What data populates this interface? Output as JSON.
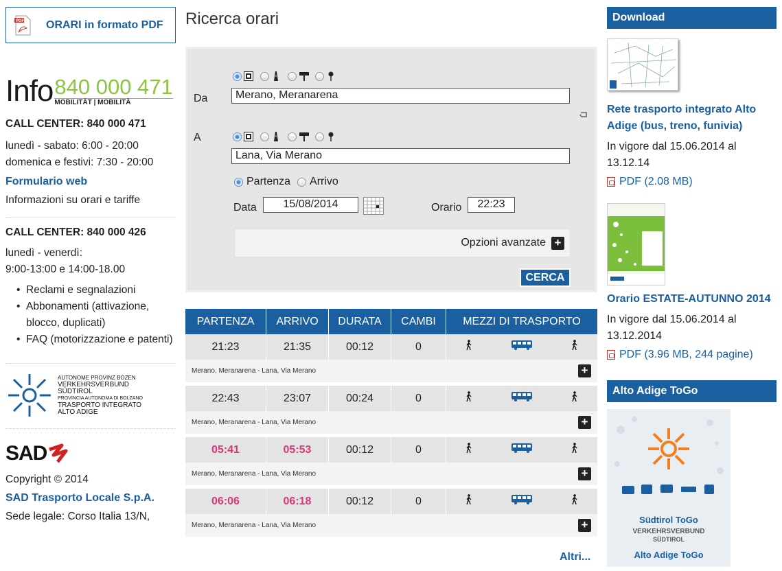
{
  "left": {
    "pdf_button": "ORARI in formato PDF",
    "info_logo": {
      "word": "Info",
      "number": "840 000 471",
      "sub": "MOBILITÄT | MOBILITÀ"
    },
    "callcenter1": {
      "title": "CALL CENTER: 840 000 471",
      "line1": "lunedì - sabato: 6:00 - 20:00",
      "line2": "domenica e festivi: 7:30 - 20:00"
    },
    "form_link": "Formulario web",
    "form_desc": "Informazioni su orari e tariffe",
    "callcenter2": {
      "title": "CALL CENTER: 840 000 426",
      "line1": "lunedì - venerdì:",
      "line2": "9:00-13:00 e 14:00-18.00"
    },
    "bullets": [
      "Reclami e segnalazioni",
      "Abbonamenti (attivazione, blocco, duplicati)",
      "FAQ (motorizzazione e patenti)"
    ],
    "vv_logo": {
      "l1": "AUTONOME PROVINZ BOZEN",
      "l2": "VERKEHRSVERBUND",
      "l3": "SÜDTIROL",
      "l4": "PROVINCIA AUTONOMA DI BOLZANO",
      "l5": "TRASPORTO INTEGRATO",
      "l6": "ALTO ADIGE"
    },
    "sad_logo": "SAD",
    "copyright": "Copyright © 2014",
    "company": "SAD Trasporto Locale S.p.A.",
    "address": "Sede legale: Corso Italia 13/N,"
  },
  "center": {
    "title": "Ricerca orari",
    "from_label": "Da",
    "from_value": "Merano, Meranarena",
    "to_label": "A",
    "to_value": "Lana, Via Merano",
    "departure": "Partenza",
    "arrival": "Arrivo",
    "date_label": "Data",
    "date_value": "15/08/2014",
    "time_label": "Orario",
    "time_value": "22:23",
    "advanced": "Opzioni avanzate",
    "search": "CERCA",
    "table": {
      "headers": [
        "PARTENZA",
        "ARRIVO",
        "DURATA",
        "CAMBI",
        "MEZZI DI TRASPORTO"
      ],
      "rows": [
        {
          "dep": "21:23",
          "arr": "21:35",
          "dur": "00:12",
          "chg": "0",
          "route": "Merano, Meranarena - Lana, Via Merano",
          "highlight": false
        },
        {
          "dep": "22:43",
          "arr": "23:07",
          "dur": "00:24",
          "chg": "0",
          "route": "Merano, Meranarena - Lana, Via Merano",
          "highlight": false
        },
        {
          "dep": "05:41",
          "arr": "05:53",
          "dur": "00:12",
          "chg": "0",
          "route": "Merano, Meranarena - Lana, Via Merano",
          "highlight": true
        },
        {
          "dep": "06:06",
          "arr": "06:18",
          "dur": "00:12",
          "chg": "0",
          "route": "Merano, Meranarena - Lana, Via Merano",
          "highlight": true
        }
      ]
    },
    "more": "Altri..."
  },
  "right": {
    "download_title": "Download",
    "item1": {
      "title": "Rete trasporto integrato Alto Adige (bus, treno, funivia)",
      "valid": "In vigore dal 15.06.2014 al 13.12.14",
      "pdf": "PDF (2.08 MB)"
    },
    "item2": {
      "title": "Orario ESTATE-AUTUNNO 2014",
      "valid": "In vigore dal 15.06.2014 al 13.12.2014",
      "pdf": "PDF (3.96 MB, 244 pagine)"
    },
    "togo_title": "Alto Adige ToGo",
    "togo_banner": {
      "l1": "Südtirol ToGo",
      "l2": "VERKEHRSVERBUND",
      "l3": "SÜDTIROL",
      "l4": "Alto Adige ToGo"
    }
  },
  "colors": {
    "primary": "#1a5fa0",
    "highlight": "#d6387a",
    "accent": "#8cc63f"
  }
}
